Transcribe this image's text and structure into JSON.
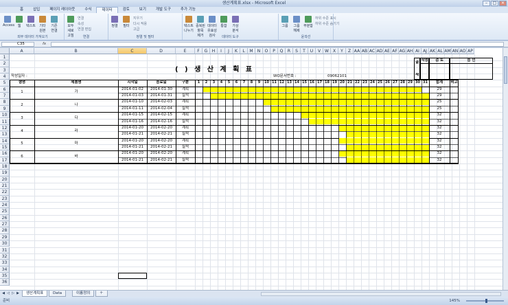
{
  "window": {
    "title": "생산계획표.xlsx - Microsoft Excel",
    "buttons": {
      "minimize": "–",
      "maximize": "□",
      "close": "✕"
    }
  },
  "ribbon": {
    "tabs": [
      "홈",
      "삽입",
      "페이지 레이아웃",
      "수식",
      "데이터",
      "검토",
      "보기",
      "개발 도구",
      "추가 기능"
    ],
    "active_tab_index": 4,
    "groups": [
      {
        "label": "외부 데이터 가져오기",
        "buttons": [
          "Access",
          "웹",
          "텍스트",
          "기타 원본",
          "기존 연결"
        ]
      },
      {
        "label": "연결",
        "buttons": [
          "모두 새로 고침"
        ],
        "small": [
          "연결",
          "속성",
          "연결 편집"
        ]
      },
      {
        "label": "정렬 및 필터",
        "buttons": [
          "정렬",
          "필터"
        ],
        "small": [
          "지우기",
          "다시 적용",
          "고급"
        ]
      },
      {
        "label": "데이터 도구",
        "buttons": [
          "텍스트 나누기",
          "중복된 항목 제거",
          "데이터 유효성 검사",
          "통합",
          "가상 분석"
        ]
      },
      {
        "label": "윤곽선",
        "buttons": [
          "그룹",
          "그룹 해제",
          "부분합"
        ],
        "small": [
          "하위 수준 표시",
          "하위 수준 숨기기"
        ]
      }
    ]
  },
  "formula_bar": {
    "cell_ref": "C35",
    "fx": "fx",
    "value": ""
  },
  "columns": [
    "A",
    "B",
    "C",
    "D",
    "E",
    "F",
    "G",
    "H",
    "I",
    "J",
    "K",
    "L",
    "M",
    "N",
    "O",
    "P",
    "Q",
    "R",
    "S",
    "T",
    "U",
    "V",
    "W",
    "X",
    "Y",
    "Z",
    "AA",
    "AB",
    "AC",
    "AD",
    "AE",
    "AF",
    "AG",
    "AH",
    "AI",
    "AJ",
    "AK",
    "AL",
    "AM",
    "AN",
    "AO",
    "AP"
  ],
  "selected_column": "C",
  "rows": [
    "1",
    "2",
    "3",
    "4",
    "5",
    "6",
    "7",
    "8",
    "9",
    "10",
    "11",
    "12",
    "13",
    "14",
    "15",
    "16",
    "17",
    "18",
    "19",
    "20",
    "21",
    "22",
    "23",
    "24",
    "25",
    "26",
    "27",
    "28",
    "29",
    "30",
    "31",
    "32",
    "33",
    "34",
    "35",
    "36"
  ],
  "sheet": {
    "title": "(    ) 생 산 계 획 표",
    "date_label": "작성일자 :",
    "wo_label": "WO문서번호 :",
    "wo_number": "09062101",
    "approval": {
      "gyeol": "결",
      "jae": "재",
      "author": "작성",
      "review": "검 토",
      "approve": "승 인"
    },
    "headers": {
      "order": "형명",
      "product": "제품명",
      "start": "시작일",
      "end": "종료일",
      "type": "구분",
      "total": "합계",
      "note": "비고"
    },
    "days": [
      "1",
      "2",
      "3",
      "4",
      "5",
      "6",
      "7",
      "8",
      "9",
      "10",
      "11",
      "12",
      "13",
      "14",
      "15",
      "16",
      "17",
      "18",
      "19",
      "20",
      "21",
      "22",
      "23",
      "24",
      "25",
      "26",
      "27",
      "28",
      "29",
      "30",
      "31"
    ],
    "items": [
      {
        "no": "1",
        "name": "가",
        "rows": [
          {
            "start": "2014-01-02",
            "end": "2014-01-30",
            "type": "계획",
            "total": "29",
            "bar_from": 2,
            "bar_to": 30
          },
          {
            "start": "2014-01-03",
            "end": "2014-01-31",
            "type": "실적",
            "total": "29",
            "bar_from": 3,
            "bar_to": 31
          }
        ]
      },
      {
        "no": "2",
        "name": "나",
        "rows": [
          {
            "start": "2014-01-10",
            "end": "2014-02-03",
            "type": "계획",
            "total": "25",
            "bar_from": 10,
            "bar_to": 31
          },
          {
            "start": "2014-01-11",
            "end": "2014-02-04",
            "type": "실적",
            "total": "25",
            "bar_from": 11,
            "bar_to": 31
          }
        ]
      },
      {
        "no": "3",
        "name": "다",
        "rows": [
          {
            "start": "2014-01-15",
            "end": "2014-02-15",
            "type": "계획",
            "total": "32",
            "bar_from": 15,
            "bar_to": 31
          },
          {
            "start": "2014-01-16",
            "end": "2014-02-16",
            "type": "실적",
            "total": "32",
            "bar_from": 16,
            "bar_to": 31
          }
        ]
      },
      {
        "no": "4",
        "name": "라",
        "rows": [
          {
            "start": "2014-01-20",
            "end": "2014-02-20",
            "type": "계획",
            "total": "32",
            "bar_from": 20,
            "bar_to": 31
          },
          {
            "start": "2014-01-21",
            "end": "2014-02-21",
            "type": "실적",
            "total": "32",
            "bar_from": 21,
            "bar_to": 31
          }
        ]
      },
      {
        "no": "5",
        "name": "마",
        "rows": [
          {
            "start": "2014-01-20",
            "end": "2014-02-20",
            "type": "계획",
            "total": "32",
            "bar_from": 20,
            "bar_to": 31
          },
          {
            "start": "2014-01-21",
            "end": "2014-02-21",
            "type": "실적",
            "total": "32",
            "bar_from": 21,
            "bar_to": 31
          }
        ]
      },
      {
        "no": "6",
        "name": "바",
        "rows": [
          {
            "start": "2014-01-20",
            "end": "2014-02-20",
            "type": "계획",
            "total": "32",
            "bar_from": 20,
            "bar_to": 31
          },
          {
            "start": "2014-01-21",
            "end": "2014-02-21",
            "type": "실적",
            "total": "32",
            "bar_from": 21,
            "bar_to": 31
          }
        ]
      }
    ]
  },
  "sheet_tabs": [
    "생산계획표",
    "Data",
    "이름정의"
  ],
  "active_sheet_tab": 0,
  "status": {
    "ready": "준비",
    "zoom": "145%"
  },
  "colors": {
    "bar": "#ffff00",
    "accent": "#1f4e8c"
  }
}
